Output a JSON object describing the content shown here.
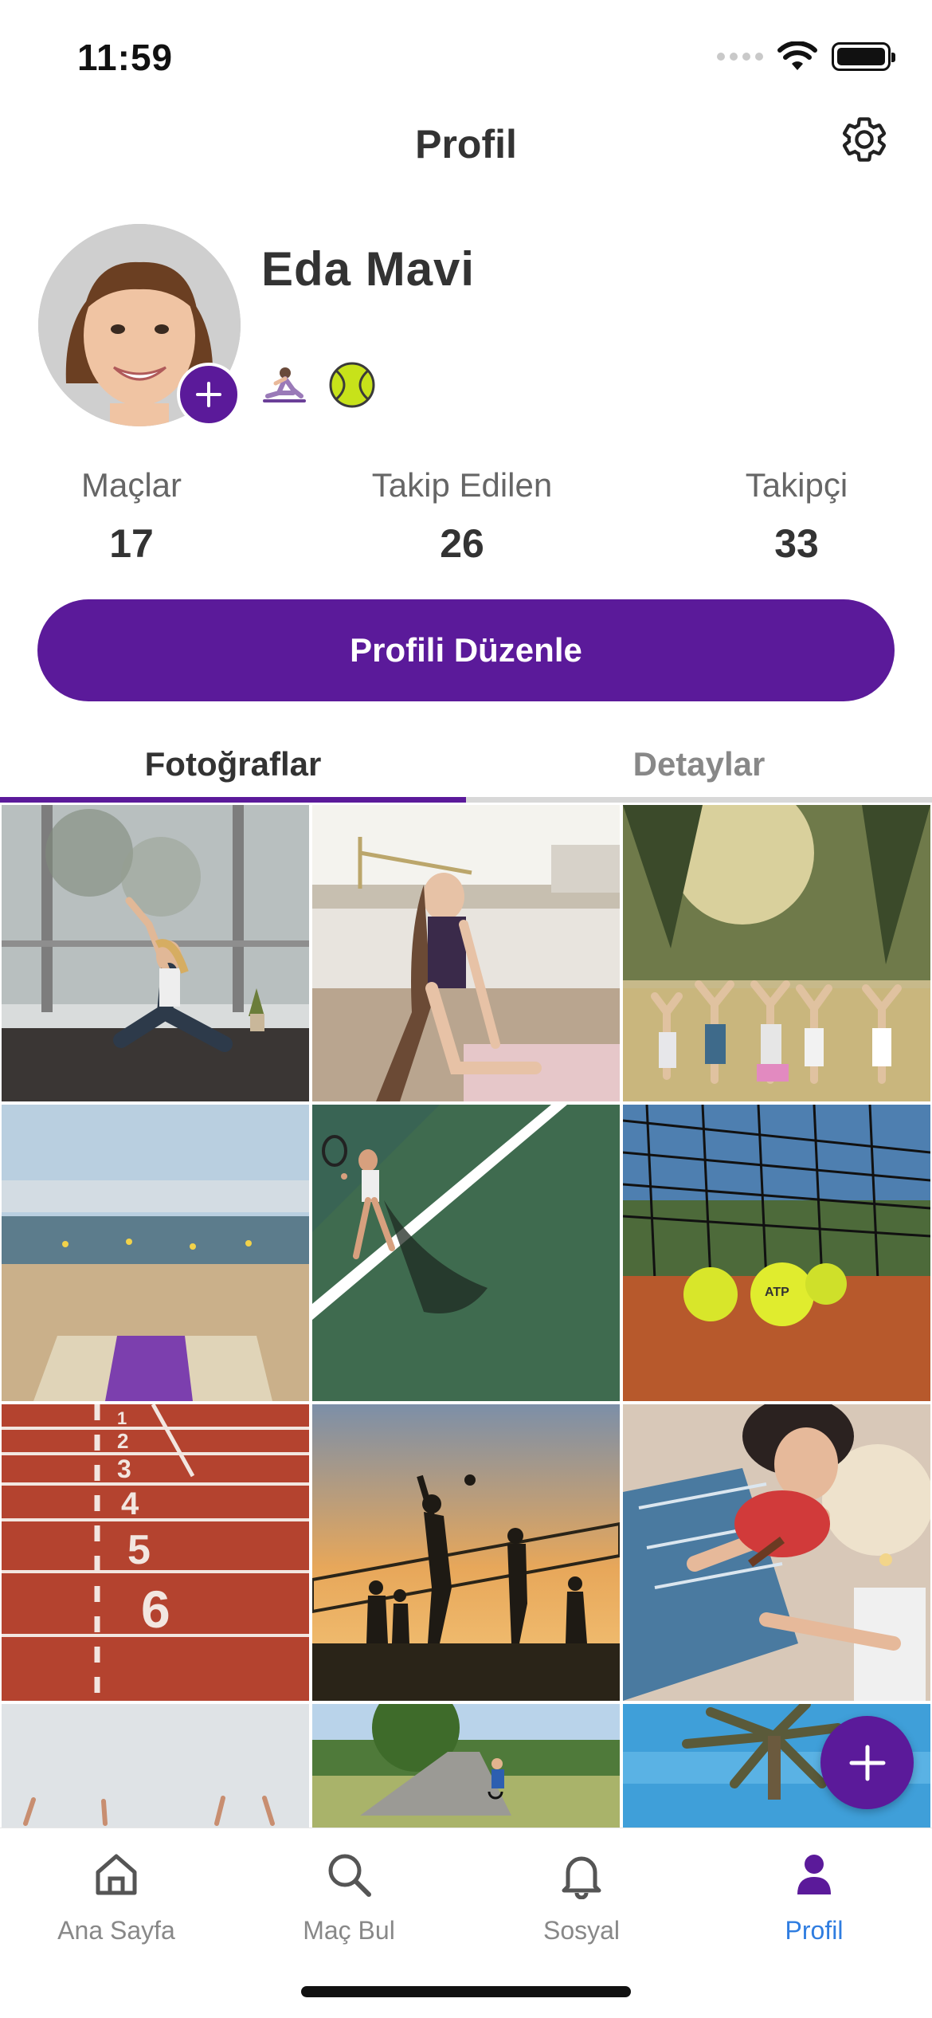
{
  "status_bar": {
    "time": "11:59"
  },
  "header": {
    "title": "Profil"
  },
  "profile": {
    "name": "Eda Mavi",
    "sports": [
      "yoga-icon",
      "tennis-ball-icon"
    ]
  },
  "stats": [
    {
      "label": "Maçlar",
      "value": "17"
    },
    {
      "label": "Takip Edilen",
      "value": "26"
    },
    {
      "label": "Takipçi",
      "value": "33"
    }
  ],
  "edit_button": {
    "label": "Profili Düzenle"
  },
  "tabs": [
    {
      "label": "Fotoğraflar",
      "active": true
    },
    {
      "label": "Detaylar",
      "active": false
    }
  ],
  "photos": [
    "yoga-studio-photo",
    "yoga-waterfront-photo",
    "group-yoga-photo",
    "beach-yoga-mat-photo",
    "tennis-player-aerial-photo",
    "tennis-balls-clay-photo",
    "running-track-photo",
    "beach-volleyball-sunset-photo",
    "table-tennis-photo",
    "sky-hands-photo",
    "road-cyclist-photo",
    "palm-tree-photo"
  ],
  "bottom_nav": [
    {
      "label": "Ana Sayfa",
      "icon": "home-icon",
      "active": false
    },
    {
      "label": "Maç Bul",
      "icon": "search-icon",
      "active": false
    },
    {
      "label": "Sosyal",
      "icon": "bell-icon",
      "active": false
    },
    {
      "label": "Profil",
      "icon": "person-icon",
      "active": true
    }
  ],
  "colors": {
    "accent": "#5b1a9a",
    "active_nav": "#2f7de0"
  }
}
